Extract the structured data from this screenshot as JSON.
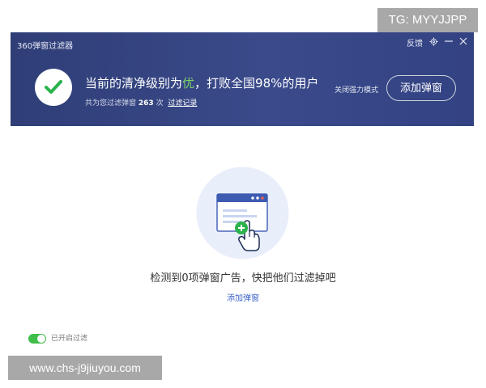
{
  "watermarks": {
    "top_right": "TG: MYYJJPP",
    "bottom_left": "www.chs-j9jiuyou.com"
  },
  "app": {
    "title": "360弹窗过滤器",
    "controls": {
      "feedback_label": "反馈",
      "settings_icon": "gear-icon",
      "minimize_icon": "minimize-icon",
      "close_icon": "close-icon"
    }
  },
  "status": {
    "icon": "check-icon",
    "main_prefix": "当前的清净级别为",
    "grade": "优",
    "main_suffix": "，打败全国98%的用户",
    "sub_prefix": "共为您过滤弹窗",
    "count": "263",
    "sub_unit": "次",
    "history_link": "过滤记录",
    "strong_mode_label": "关闭强力模式",
    "add_button_label": "添加弹窗"
  },
  "empty_state": {
    "illustration_icon": "popup-window-illustration",
    "message": "检测到0项弹窗广告，快把他们过滤掉吧",
    "add_link": "添加弹窗"
  },
  "filter_toggle": {
    "state": "on",
    "label": "已开启过滤"
  },
  "colors": {
    "header_bg": "#34437f",
    "grade_green": "#7bd36b",
    "check_green": "#2bb24c",
    "link_blue": "#3d63c9",
    "toggle_green": "#3fbf4a"
  }
}
